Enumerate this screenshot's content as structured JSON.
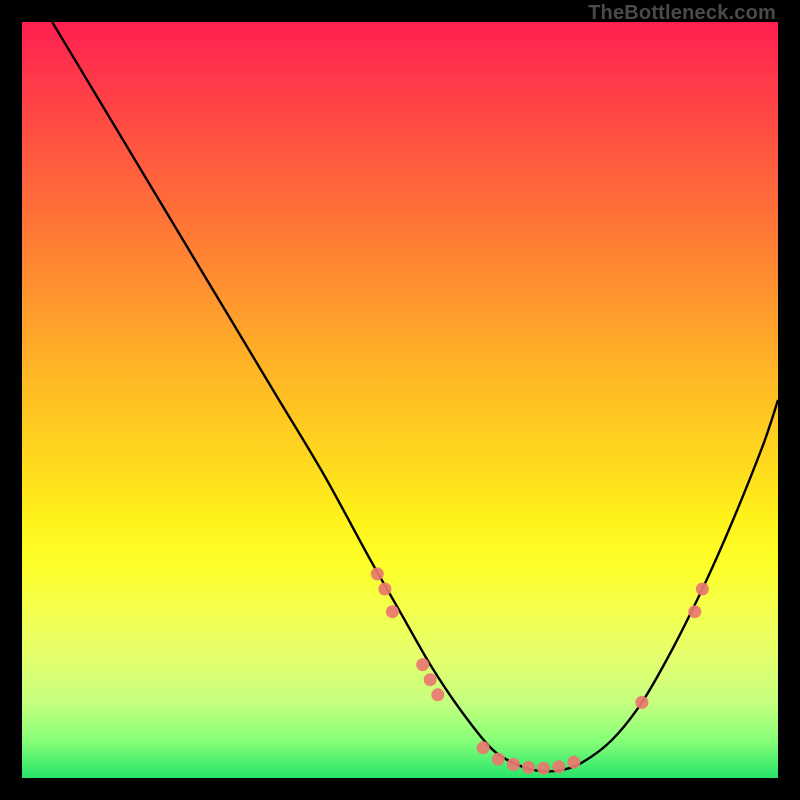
{
  "watermark": "TheBottleneck.com",
  "chart_data": {
    "type": "line",
    "title": "",
    "xlabel": "",
    "ylabel": "",
    "xlim": [
      0,
      100
    ],
    "ylim": [
      0,
      100
    ],
    "grid": false,
    "series": [
      {
        "name": "bottleneck-curve",
        "x": [
          4,
          10,
          16,
          22,
          28,
          34,
          40,
          46,
          50,
          54,
          58,
          62,
          65,
          68,
          71,
          74,
          78,
          82,
          86,
          90,
          94,
          98,
          100
        ],
        "y": [
          100,
          90,
          80,
          70,
          60,
          50,
          40,
          29,
          22,
          15,
          9,
          4,
          2,
          1,
          1,
          2,
          5,
          10,
          17,
          25,
          34,
          44,
          50
        ]
      }
    ],
    "markers": [
      {
        "name": "left-cluster-1",
        "x": 47,
        "y": 27
      },
      {
        "name": "left-cluster-2",
        "x": 48,
        "y": 25
      },
      {
        "name": "left-cluster-3",
        "x": 49,
        "y": 22
      },
      {
        "name": "left-cluster-4",
        "x": 53,
        "y": 15
      },
      {
        "name": "left-cluster-5",
        "x": 54,
        "y": 13
      },
      {
        "name": "left-cluster-6",
        "x": 55,
        "y": 11
      },
      {
        "name": "trough-1",
        "x": 61,
        "y": 4
      },
      {
        "name": "trough-2",
        "x": 63,
        "y": 2.5
      },
      {
        "name": "trough-3",
        "x": 65,
        "y": 1.8
      },
      {
        "name": "trough-4",
        "x": 67,
        "y": 1.4
      },
      {
        "name": "trough-5",
        "x": 69,
        "y": 1.3
      },
      {
        "name": "trough-6",
        "x": 71,
        "y": 1.5
      },
      {
        "name": "trough-7",
        "x": 73,
        "y": 2.1
      },
      {
        "name": "right-cluster-1",
        "x": 82,
        "y": 10
      },
      {
        "name": "right-cluster-2",
        "x": 89,
        "y": 22
      },
      {
        "name": "right-cluster-3",
        "x": 90,
        "y": 25
      }
    ],
    "colors": {
      "curve": "#000000",
      "marker": "#e9786f",
      "gradient_top": "#ff1f4f",
      "gradient_bottom": "#26e46a"
    }
  }
}
